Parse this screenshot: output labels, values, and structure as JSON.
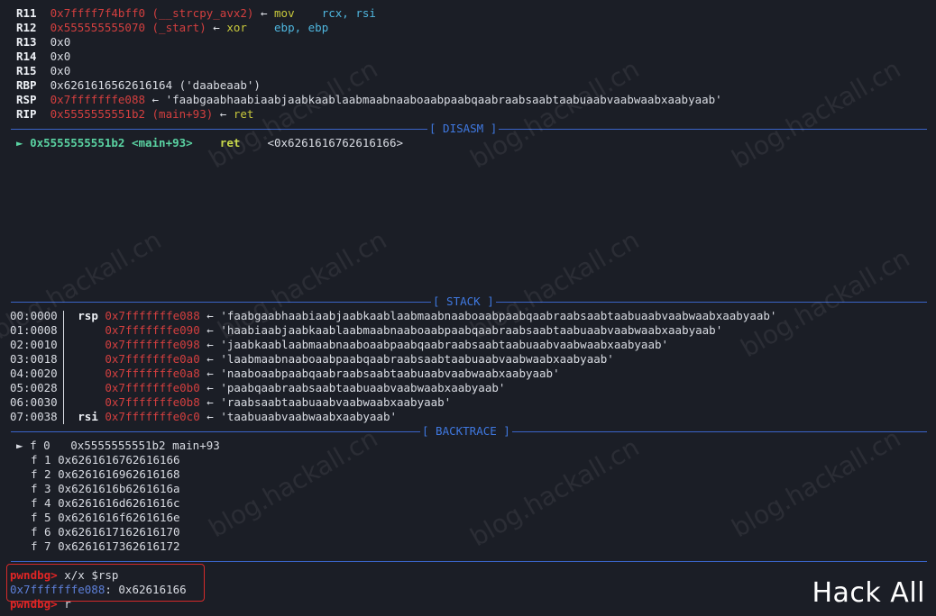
{
  "registers": [
    {
      "name": "R11",
      "addr": "0x7ffff7f4bff0",
      "sym": "(__strcpy_avx2)",
      "arrow": "←",
      "op": "mov",
      "args": "rcx, rsi"
    },
    {
      "name": "R12",
      "addr": "0x555555555070",
      "sym": "(_start)",
      "arrow": "←",
      "op": "xor",
      "args": "ebp, ebp"
    },
    {
      "name": "R13",
      "value": "0x0"
    },
    {
      "name": "R14",
      "value": "0x0"
    },
    {
      "name": "R15",
      "value": "0x0"
    },
    {
      "name": "RBP",
      "value": "0x6261616562616164 ('daabeaab')"
    },
    {
      "name": "RSP",
      "addr": "0x7fffffffe088",
      "arrow": "←",
      "str": "'faabgaabhaabiaabjaabkaablaabmaabnaaboaabpaabqaabraabsaabtaabuaabvaabwaabxaabyaab'"
    },
    {
      "name": "RIP",
      "addr": "0x5555555551b2",
      "sym": "(main+93)",
      "arrow": "←",
      "op": "ret"
    }
  ],
  "disasm": {
    "title": "[ DISASM ]",
    "line": {
      "marker": "►",
      "addr": "0x5555555551b2",
      "sym": "<main+93>",
      "op": "ret",
      "target": "<0x6261616762616166>"
    }
  },
  "stack": {
    "title": "[ STACK ]",
    "rows": [
      {
        "off": "00:0000",
        "reg": "rsp",
        "addr": "0x7fffffffe088",
        "arrow": "←",
        "str": "'faabgaabhaabiaabjaabkaablaabmaabnaaboaabpaabqaabraabsaabtaabuaabvaabwaabxaabyaab'"
      },
      {
        "off": "01:0008",
        "reg": "",
        "addr": "0x7fffffffe090",
        "arrow": "←",
        "str": "'haabiaabjaabkaablaabmaabnaaboaabpaabqaabraabsaabtaabuaabvaabwaabxaabyaab'"
      },
      {
        "off": "02:0010",
        "reg": "",
        "addr": "0x7fffffffe098",
        "arrow": "←",
        "str": "'jaabkaablaabmaabnaaboaabpaabqaabraabsaabtaabuaabvaabwaabxaabyaab'"
      },
      {
        "off": "03:0018",
        "reg": "",
        "addr": "0x7fffffffe0a0",
        "arrow": "←",
        "str": "'laabmaabnaaboaabpaabqaabraabsaabtaabuaabvaabwaabxaabyaab'"
      },
      {
        "off": "04:0020",
        "reg": "",
        "addr": "0x7fffffffe0a8",
        "arrow": "←",
        "str": "'naaboaabpaabqaabraabsaabtaabuaabvaabwaabxaabyaab'"
      },
      {
        "off": "05:0028",
        "reg": "",
        "addr": "0x7fffffffe0b0",
        "arrow": "←",
        "str": "'paabqaabraabsaabtaabuaabvaabwaabxaabyaab'"
      },
      {
        "off": "06:0030",
        "reg": "",
        "addr": "0x7fffffffe0b8",
        "arrow": "←",
        "str": "'raabsaabtaabuaabvaabwaabxaabyaab'"
      },
      {
        "off": "07:0038",
        "reg": "rsi",
        "addr": "0x7fffffffe0c0",
        "arrow": "←",
        "str": "'taabuaabvaabwaabxaabyaab'"
      }
    ]
  },
  "backtrace": {
    "title": "[ BACKTRACE ]",
    "frames": [
      {
        "marker": "►",
        "frame": "f 0",
        "addr": "  0x5555555551b2 main+93"
      },
      {
        "marker": "",
        "frame": "f 1",
        "addr": "0x6261616762616166"
      },
      {
        "marker": "",
        "frame": "f 2",
        "addr": "0x6261616962616168"
      },
      {
        "marker": "",
        "frame": "f 3",
        "addr": "0x6261616b6261616a"
      },
      {
        "marker": "",
        "frame": "f 4",
        "addr": "0x6261616d6261616c"
      },
      {
        "marker": "",
        "frame": "f 5",
        "addr": "0x6261616f6261616e"
      },
      {
        "marker": "",
        "frame": "f 6",
        "addr": "0x6261617162616170"
      },
      {
        "marker": "",
        "frame": "f 7",
        "addr": "0x6261617362616172"
      }
    ]
  },
  "console": {
    "prompt": "pwndbg>",
    "cmd1": " x/x $rsp",
    "result_addr": "0x7fffffffe088",
    "result_val": ": 0x62616166",
    "cmd2": " r"
  },
  "watermark": "blog.hackall.cn",
  "brand": "Hack All"
}
